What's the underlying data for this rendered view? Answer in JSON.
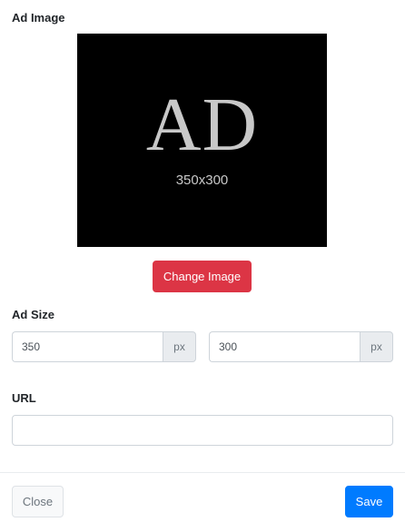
{
  "ad_image": {
    "label": "Ad Image",
    "preview_big_text": "AD",
    "preview_dims_text": "350x300",
    "change_button_label": "Change Image"
  },
  "ad_size": {
    "label": "Ad Size",
    "width_value": "350",
    "width_unit": "px",
    "height_value": "300",
    "height_unit": "px"
  },
  "url": {
    "label": "URL",
    "value": ""
  },
  "footer": {
    "close_label": "Close",
    "save_label": "Save"
  },
  "colors": {
    "danger": "#dc3545",
    "primary": "#007bff",
    "preview_background": "#000000",
    "preview_text": "#c8c8c8"
  }
}
